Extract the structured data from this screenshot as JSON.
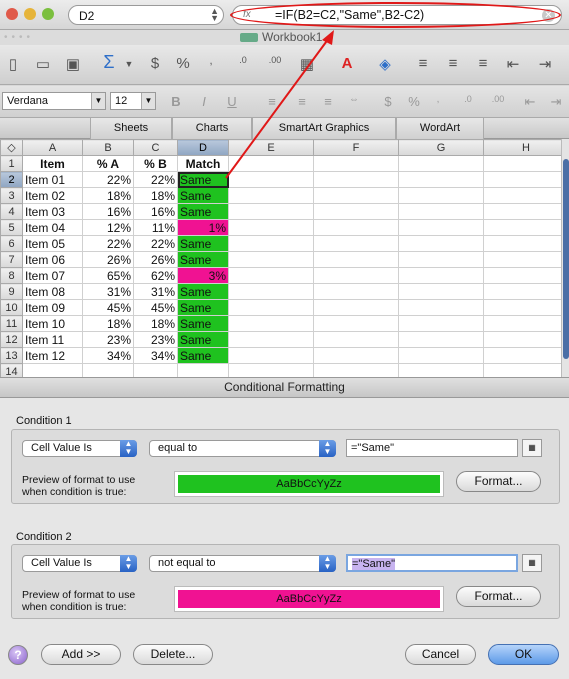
{
  "formula_bar": {
    "name_box": "D2",
    "fx_label": "fx",
    "formula": "=IF(B2=C2,\"Same\",B2-C2)"
  },
  "window": {
    "title": "Workbook1"
  },
  "font_bar": {
    "font": "Verdana",
    "size": "12"
  },
  "ribbon_tabs": [
    "Sheets",
    "Charts",
    "SmartArt Graphics",
    "WordArt"
  ],
  "columns": [
    "A",
    "B",
    "C",
    "D",
    "E",
    "F",
    "G",
    "H"
  ],
  "rows": [
    {
      "n": "1",
      "a": "Item",
      "b": "% A",
      "c": "% B",
      "d": "Match",
      "fmt": "header"
    },
    {
      "n": "2",
      "a": "Item 01",
      "b": "22%",
      "c": "22%",
      "d": "Same",
      "fmt": "green"
    },
    {
      "n": "3",
      "a": "Item 02",
      "b": "18%",
      "c": "18%",
      "d": "Same",
      "fmt": "green"
    },
    {
      "n": "4",
      "a": "Item 03",
      "b": "16%",
      "c": "16%",
      "d": "Same",
      "fmt": "green"
    },
    {
      "n": "5",
      "a": "Item 04",
      "b": "12%",
      "c": "11%",
      "d": "1%",
      "fmt": "pink"
    },
    {
      "n": "6",
      "a": "Item 05",
      "b": "22%",
      "c": "22%",
      "d": "Same",
      "fmt": "green"
    },
    {
      "n": "7",
      "a": "Item 06",
      "b": "26%",
      "c": "26%",
      "d": "Same",
      "fmt": "green"
    },
    {
      "n": "8",
      "a": "Item 07",
      "b": "65%",
      "c": "62%",
      "d": "3%",
      "fmt": "pink"
    },
    {
      "n": "9",
      "a": "Item 08",
      "b": "31%",
      "c": "31%",
      "d": "Same",
      "fmt": "green"
    },
    {
      "n": "10",
      "a": "Item 09",
      "b": "45%",
      "c": "45%",
      "d": "Same",
      "fmt": "green"
    },
    {
      "n": "11",
      "a": "Item 10",
      "b": "18%",
      "c": "18%",
      "d": "Same",
      "fmt": "green"
    },
    {
      "n": "12",
      "a": "Item 11",
      "b": "23%",
      "c": "23%",
      "d": "Same",
      "fmt": "green"
    },
    {
      "n": "13",
      "a": "Item 12",
      "b": "34%",
      "c": "34%",
      "d": "Same",
      "fmt": "green"
    },
    {
      "n": "14",
      "a": "",
      "b": "",
      "c": "",
      "d": "",
      "fmt": "empty"
    }
  ],
  "colors": {
    "same_fill": "#1fc21f",
    "diff_fill": "#f01292",
    "annotation": "#e01818"
  },
  "dialog": {
    "title": "Conditional Formatting",
    "condition1": {
      "label": "Condition 1",
      "type": "Cell Value Is",
      "operator": "equal to",
      "value": "=\"Same\"",
      "preview_label_1": "Preview of format to use",
      "preview_label_2": "when condition is true:",
      "preview_text": "AaBbCcYyZz",
      "format_button": "Format..."
    },
    "condition2": {
      "label": "Condition 2",
      "type": "Cell Value Is",
      "operator": "not equal to",
      "value": "=\"Same\"",
      "preview_label_1": "Preview of format to use",
      "preview_label_2": "when condition is true:",
      "preview_text": "AaBbCcYyZz",
      "format_button": "Format..."
    },
    "help": "?",
    "add_button": "Add >>",
    "delete_button": "Delete...",
    "cancel_button": "Cancel",
    "ok_button": "OK"
  }
}
